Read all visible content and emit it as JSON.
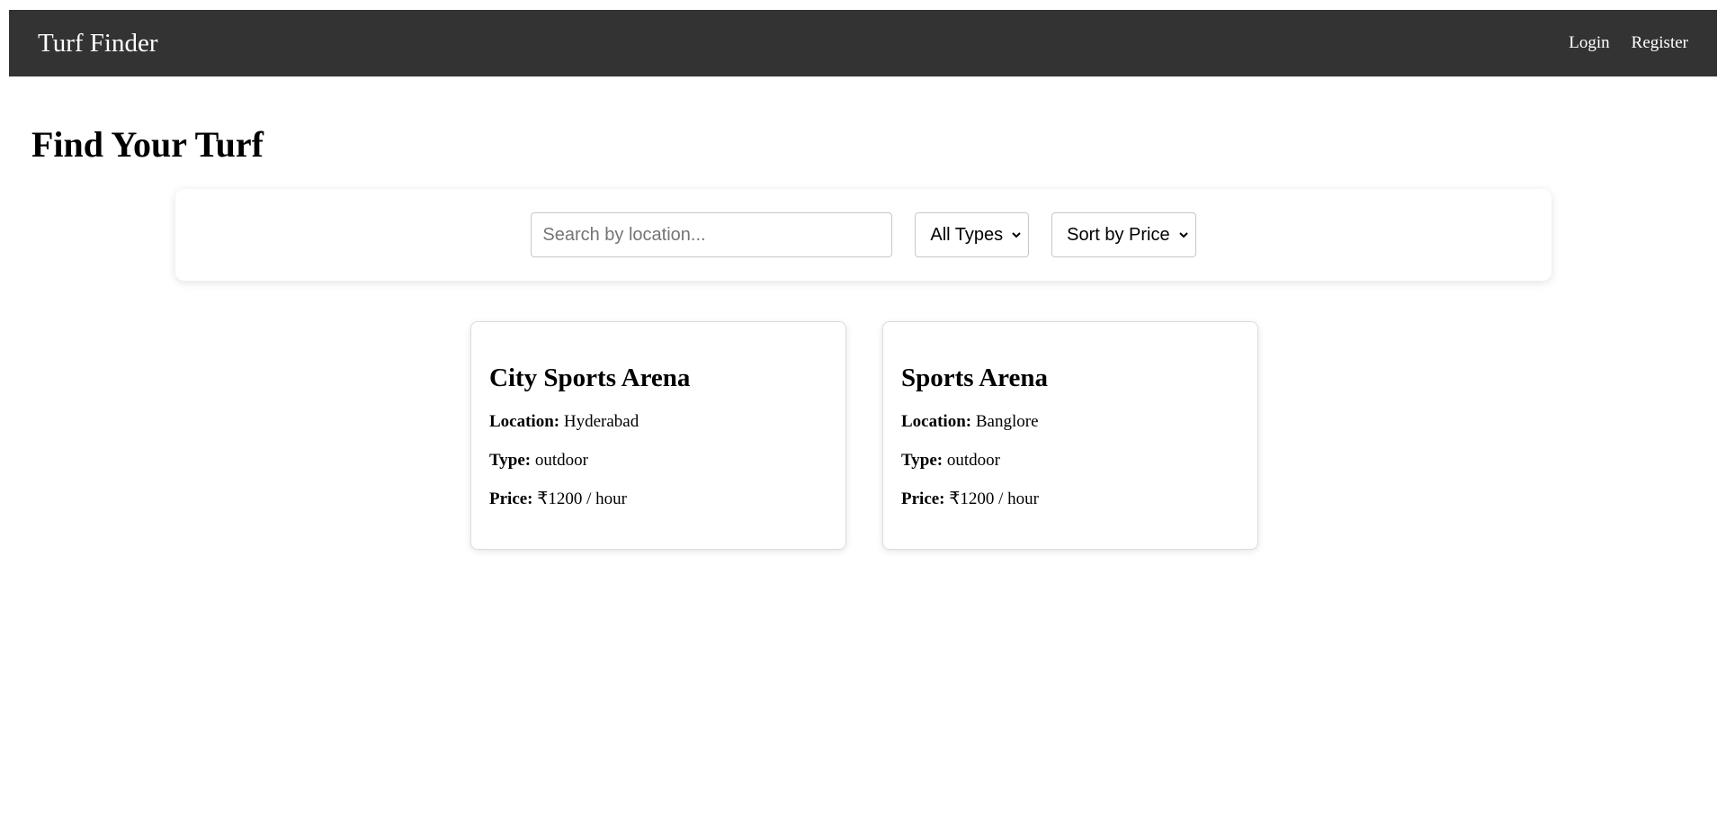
{
  "header": {
    "brand": "Turf Finder",
    "nav": {
      "login": "Login",
      "register": "Register"
    }
  },
  "main": {
    "title": "Find Your Turf"
  },
  "filters": {
    "search_placeholder": "Search by location...",
    "type_select": "All Types",
    "sort_select": "Sort by Price"
  },
  "turfs": [
    {
      "name": "City Sports Arena",
      "location_label": "Location:",
      "location": "Hyderabad",
      "type_label": "Type:",
      "type": "outdoor",
      "price_label": "Price:",
      "price": "₹1200 / hour"
    },
    {
      "name": "Sports Arena",
      "location_label": "Location:",
      "location": "Banglore",
      "type_label": "Type:",
      "type": "outdoor",
      "price_label": "Price:",
      "price": "₹1200 / hour"
    }
  ],
  "colors": {
    "header_bg": "#333333",
    "header_text": "#ffffff"
  }
}
